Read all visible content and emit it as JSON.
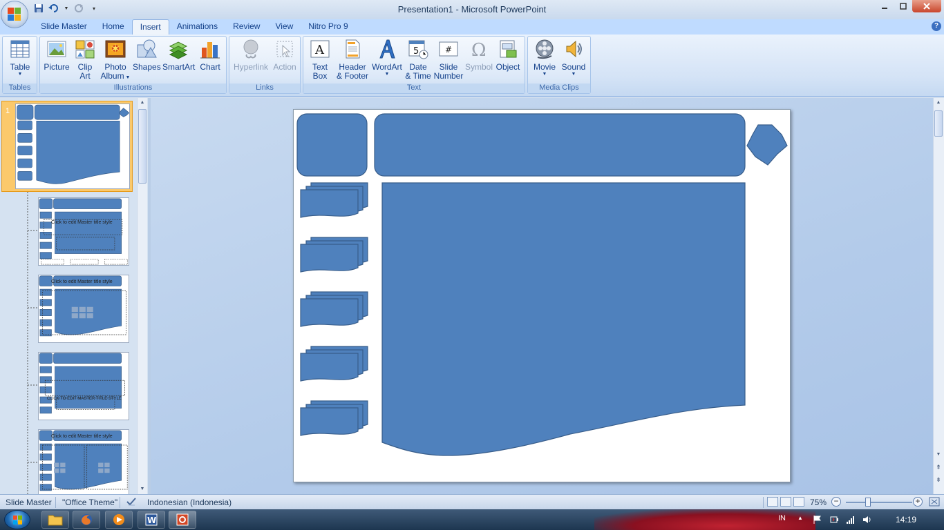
{
  "window": {
    "title": "Presentation1 - Microsoft PowerPoint"
  },
  "tabs": [
    {
      "label": "Slide Master"
    },
    {
      "label": "Home"
    },
    {
      "label": "Insert"
    },
    {
      "label": "Animations"
    },
    {
      "label": "Review"
    },
    {
      "label": "View"
    },
    {
      "label": "Nitro Pro 9"
    }
  ],
  "ribbon": {
    "groups": {
      "tables": "Tables",
      "illustrations": "Illustrations",
      "links": "Links",
      "text": "Text",
      "media": "Media Clips"
    },
    "buttons": {
      "table": "Table",
      "picture": "Picture",
      "clip_art_1": "Clip",
      "clip_art_2": "Art",
      "photo_album_1": "Photo",
      "photo_album_2": "Album",
      "shapes": "Shapes",
      "smartart": "SmartArt",
      "chart": "Chart",
      "hyperlink": "Hyperlink",
      "action": "Action",
      "text_box_1": "Text",
      "text_box_2": "Box",
      "header_footer_1": "Header",
      "header_footer_2": "& Footer",
      "wordart": "WordArt",
      "date_time_1": "Date",
      "date_time_2": "& Time",
      "slide_number_1": "Slide",
      "slide_number_2": "Number",
      "symbol": "Symbol",
      "object": "Object",
      "movie": "Movie",
      "sound": "Sound"
    }
  },
  "thumbnails": {
    "first_number": "1",
    "thumb2_title": "Click to edit Master title style",
    "thumb3_title": "Click to edit Master title style",
    "thumb4_title": "CLICK TO EDIT MASTER TITLE STYLE",
    "thumb5_title": "Click to edit Master title style"
  },
  "statusbar": {
    "view": "Slide Master",
    "theme": "\"Office Theme\"",
    "language": "Indonesian (Indonesia)",
    "zoom": "75%",
    "zoom_level": 0.75
  },
  "taskbar": {
    "lang": "IN",
    "time": "14:19"
  },
  "colors": {
    "shape_fill": "#4f81bd",
    "shape_stroke": "#385d8a",
    "selection": "#f4a535"
  }
}
